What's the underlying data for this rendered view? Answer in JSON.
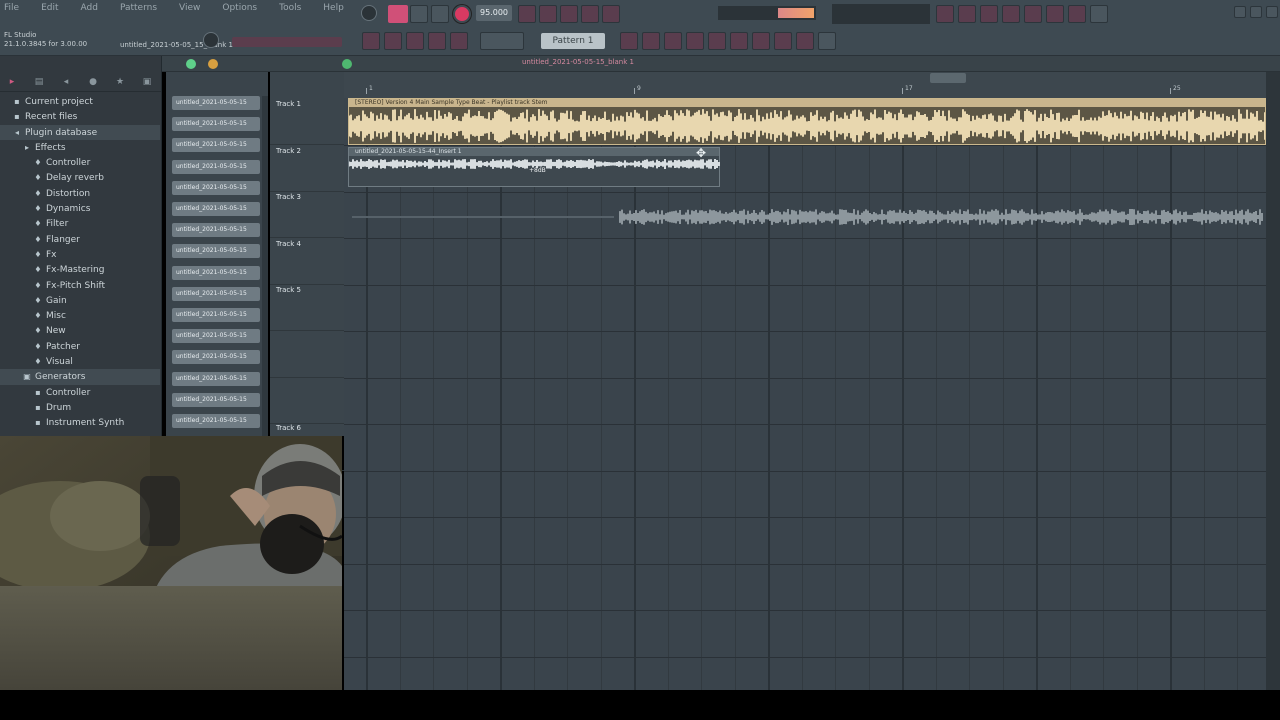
{
  "app": {
    "title": "FL Studio",
    "version": "21.1.0.3845 for 3.00.00",
    "project_name": "untitled_2021-05-05_15_blank 1"
  },
  "menu": [
    "File",
    "Edit",
    "Add",
    "Patterns",
    "View",
    "Options",
    "Tools",
    "Help"
  ],
  "toolbar": {
    "tempo": "95.000",
    "pattern": "Pattern 1"
  },
  "browser": {
    "items": [
      {
        "label": "Current project",
        "glyph": "▪",
        "level": "lvl0"
      },
      {
        "label": "Recent files",
        "glyph": "▪",
        "level": "lvl0"
      },
      {
        "label": "Plugin database",
        "glyph": "◂",
        "level": "lvl0",
        "selected": true
      },
      {
        "label": "Effects",
        "glyph": "▸",
        "level": "lvl1"
      },
      {
        "label": "Controller",
        "glyph": "♦",
        "level": "lvl2"
      },
      {
        "label": "Delay reverb",
        "glyph": "♦",
        "level": "lvl2"
      },
      {
        "label": "Distortion",
        "glyph": "♦",
        "level": "lvl2"
      },
      {
        "label": "Dynamics",
        "glyph": "♦",
        "level": "lvl2"
      },
      {
        "label": "Filter",
        "glyph": "♦",
        "level": "lvl2"
      },
      {
        "label": "Flanger",
        "glyph": "♦",
        "level": "lvl2"
      },
      {
        "label": "Fx",
        "glyph": "♦",
        "level": "lvl2"
      },
      {
        "label": "Fx-Mastering",
        "glyph": "♦",
        "level": "lvl2"
      },
      {
        "label": "Fx-Pitch Shift",
        "glyph": "♦",
        "level": "lvl2"
      },
      {
        "label": "Gain",
        "glyph": "♦",
        "level": "lvl2"
      },
      {
        "label": "Misc",
        "glyph": "♦",
        "level": "lvl2"
      },
      {
        "label": "New",
        "glyph": "♦",
        "level": "lvl2"
      },
      {
        "label": "Patcher",
        "glyph": "♦",
        "level": "lvl2"
      },
      {
        "label": "Visual",
        "glyph": "♦",
        "level": "lvl2"
      },
      {
        "label": "Generators",
        "glyph": "▣",
        "level": "lvl1g",
        "selected": true
      },
      {
        "label": "Controller",
        "glyph": "▪",
        "level": "lvl2"
      },
      {
        "label": "Drum",
        "glyph": "▪",
        "level": "lvl2"
      },
      {
        "label": "Instrument Synth",
        "glyph": "▪",
        "level": "lvl2"
      }
    ]
  },
  "channels": [
    "untitled_2021-05-05-15",
    "untitled_2021-05-05-15",
    "untitled_2021-05-05-15",
    "untitled_2021-05-05-15",
    "untitled_2021-05-05-15",
    "untitled_2021-05-05-15",
    "untitled_2021-05-05-15",
    "untitled_2021-05-05-15",
    "untitled_2021-05-05-15",
    "untitled_2021-05-05-15",
    "untitled_2021-05-05-15",
    "untitled_2021-05-05-15",
    "untitled_2021-05-05-15",
    "untitled_2021-05-05-15",
    "untitled_2021-05-05-15",
    "untitled_2021-05-05-15"
  ],
  "playlist": {
    "title": "untitled_2021-05-05-15_blank 1",
    "tracks": [
      "Track 1",
      "Track 2",
      "Track 3",
      "Track 4",
      "Track 5",
      "Track 6"
    ],
    "ruler": [
      "1",
      "9",
      "17",
      "25"
    ],
    "clips": {
      "main": "[STEREO] Version 4 Main Sample Type Beat - Playlist track Stem",
      "vocal": "untitled_2021-05-05-15-44_Insert 1",
      "marker": "+8dB"
    }
  },
  "colors": {
    "accent": "#d83a62",
    "clip_audio": "#c9b58d",
    "grid_bg": "#3a444c"
  }
}
